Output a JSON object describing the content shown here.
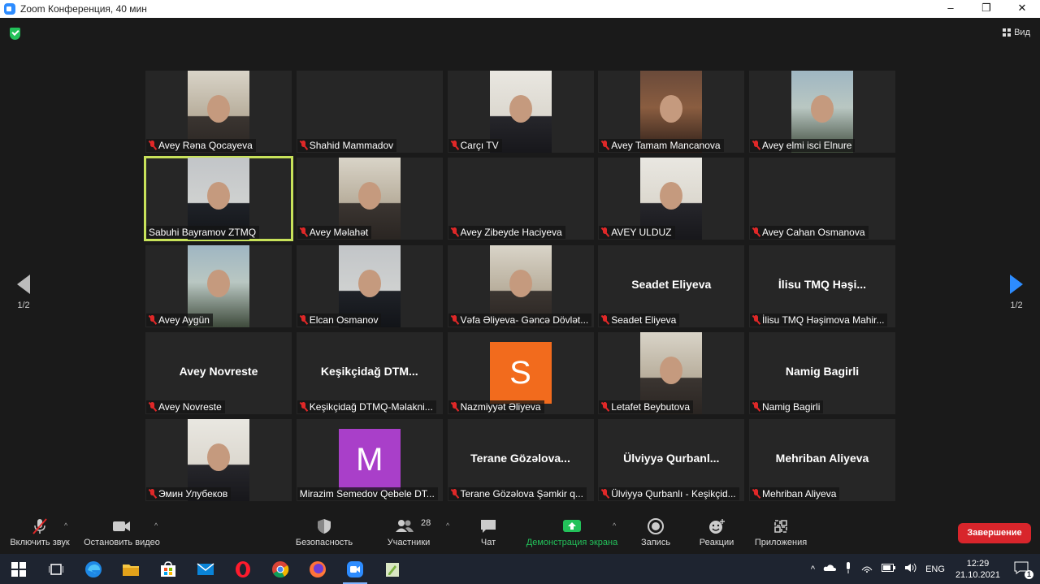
{
  "window": {
    "title": "Zoom Конференция, 40 мин",
    "controls": [
      "‒",
      "❐",
      "✕"
    ]
  },
  "header": {
    "view_label": "Вид"
  },
  "pager": {
    "left_page": "1/2",
    "right_page": "1/2"
  },
  "tiles": [
    {
      "name": "Avey Rəna Qocayeva",
      "kind": "video"
    },
    {
      "name": "Shahid Mammadov",
      "kind": "blank"
    },
    {
      "name": "Carçı TV",
      "kind": "video"
    },
    {
      "name": "Avey Tamam Mancanova",
      "kind": "video"
    },
    {
      "name": "Avey elmi isci Elnure",
      "kind": "video"
    },
    {
      "name": "Sabuhi Bayramov ZTMQ",
      "kind": "video",
      "active": true,
      "muted": false
    },
    {
      "name": "Avey Məlahət",
      "kind": "video"
    },
    {
      "name": "Avey Zibeyde Haciyeva",
      "kind": "blank"
    },
    {
      "name": "AVEY ULDUZ",
      "kind": "video"
    },
    {
      "name": "Avey Cahan Osmanova",
      "kind": "blank"
    },
    {
      "name": "Avey Aygün",
      "kind": "video"
    },
    {
      "name": "Elcan Osmanov",
      "kind": "video"
    },
    {
      "name": "Vəfa Əliyeva- Gəncə Dövlət...",
      "kind": "video"
    },
    {
      "name": "Seadet Eliyeva",
      "kind": "text",
      "center": "Seadet Eliyeva"
    },
    {
      "name": "İlisu TMQ Həşimova Mahir...",
      "kind": "text",
      "center": "İlisu  TMQ  Həşi..."
    },
    {
      "name": "Avey Novreste",
      "kind": "text",
      "center": "Avey Novreste"
    },
    {
      "name": "Keşikçidağ DTMQ-Məlakni...",
      "kind": "text",
      "center": "Keşikçidağ  DTM..."
    },
    {
      "name": "Nazmiyyət Əliyeva",
      "kind": "avatar",
      "letter": "S",
      "color": "#f26b1d"
    },
    {
      "name": "Letafet Beybutova",
      "kind": "video"
    },
    {
      "name": "Namig Bagirli",
      "kind": "text",
      "center": "Namig Bagirli"
    },
    {
      "name": "Эмин Улубеков",
      "kind": "video"
    },
    {
      "name": "Mirazim Semedov Qebele DT...",
      "kind": "avatar",
      "letter": "M",
      "color": "#a93fc9",
      "muted": false
    },
    {
      "name": "Terane Gözəlova Şəmkir q...",
      "kind": "text",
      "center": "Terane  Gözəlova..."
    },
    {
      "name": "Ülviyyə Qurbanlı - Keşikçid...",
      "kind": "text",
      "center": "Ülviyyə  Qurbanl..."
    },
    {
      "name": "Mehriban Aliyeva",
      "kind": "text",
      "center": "Mehriban Aliyeva"
    }
  ],
  "toolbar": {
    "unmute": "Включить звук",
    "stop_video": "Остановить видео",
    "security": "Безопасность",
    "participants": "Участники",
    "participants_count": "28",
    "chat": "Чат",
    "share_screen": "Демонстрация экрана",
    "record": "Запись",
    "reactions": "Реакции",
    "apps": "Приложения",
    "end": "Завершение"
  },
  "taskbar": {
    "apps": [
      "start-icon",
      "task-view-icon",
      "edge-icon",
      "file-explorer-icon",
      "store-icon",
      "mail-icon",
      "opera-icon",
      "chrome-icon",
      "firefox-icon",
      "zoom-icon",
      "notepad-icon"
    ],
    "language": "ENG",
    "time": "12:29",
    "date": "21.10.2021",
    "notifications_count": "1"
  },
  "colors": {
    "accent": "#2d8cff",
    "end": "#d8252b",
    "active_speaker": "#c8e25a",
    "share": "#23c15a",
    "muted": "#e02828"
  }
}
